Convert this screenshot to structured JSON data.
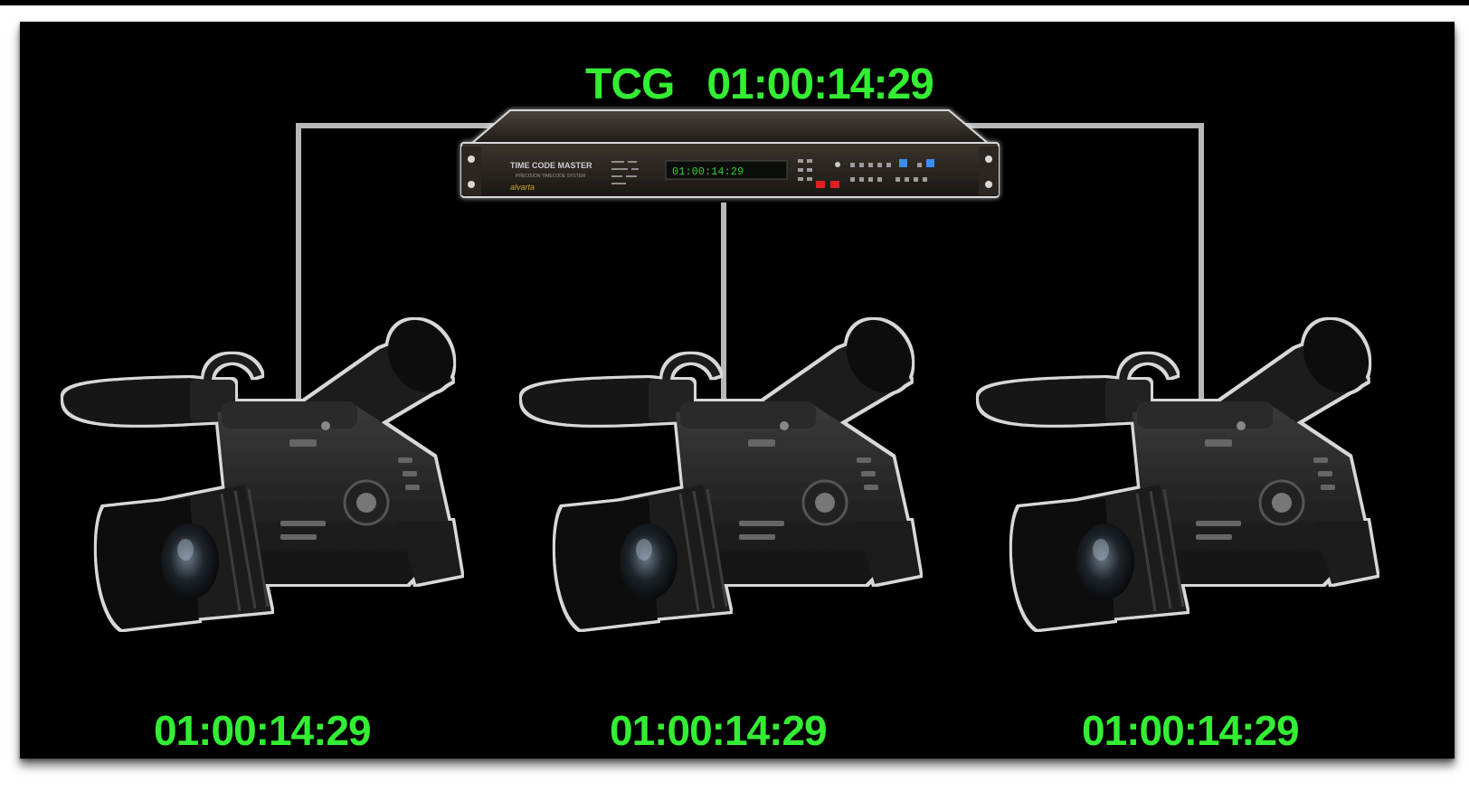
{
  "generator": {
    "label": "TCG",
    "timecode": "01:00:14:29",
    "device_brand": "TIME CODE MASTER",
    "device_sub": "PRECISION TIMECODE SYSTEM",
    "device_logo": "alvarta",
    "display_text": "01:00:14:29"
  },
  "cameras": [
    {
      "timecode": "01:00:14:29",
      "icon": "video-camera-icon"
    },
    {
      "timecode": "01:00:14:29",
      "icon": "video-camera-icon"
    },
    {
      "timecode": "01:00:14:29",
      "icon": "video-camera-icon"
    }
  ],
  "colors": {
    "background": "#000000",
    "timecode_text": "#33ee33",
    "wire": "#b8b8b8",
    "device_body": "#2a2520",
    "device_led": "#2ed02e",
    "device_button_red": "#e02020",
    "device_button_blue": "#3a8ef0"
  }
}
